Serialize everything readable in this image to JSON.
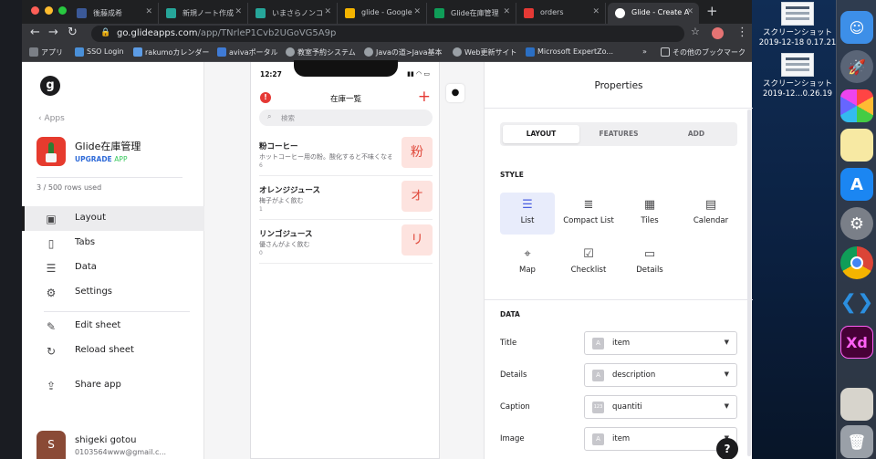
{
  "browser": {
    "tabs": [
      {
        "label": "後藤成希",
        "icon": "facebook-icon",
        "color": "#3b5998"
      },
      {
        "label": "新規ノート作成",
        "icon": "notion-icon",
        "color": "#26a69a"
      },
      {
        "label": "いまさらノンコ",
        "icon": "notion-icon",
        "color": "#26a69a"
      },
      {
        "label": "glide - Google",
        "icon": "google-drive-icon",
        "color": "#f4b400"
      },
      {
        "label": "Glide在庫管理",
        "icon": "sheets-icon",
        "color": "#0f9d58"
      },
      {
        "label": "orders",
        "icon": "app-icon",
        "color": "#e53935"
      },
      {
        "label": "Glide - Create A",
        "icon": "glide-icon",
        "color": "#ffffff"
      }
    ],
    "url_host": "go.glideapps.com",
    "url_path": "/app/TNrleP1Cvb2UGoVG5A9p",
    "bookmarks": [
      "アプリ",
      "SSO Login",
      "rakumoカレンダー",
      "avivaポータル",
      "教室予約システム",
      "Javaの道>Java基本",
      "Web更新サイト",
      "Microsoft ExpertZo..."
    ],
    "bookmarks_more": "»",
    "bookmarks_other": "その他のブックマーク"
  },
  "sidebar": {
    "back": "Apps",
    "app_name": "Glide在庫管理",
    "upgrade": "UPGRADE",
    "plan": "APP",
    "rows_used": "3 / 500 rows used",
    "menu": [
      {
        "label": "Layout",
        "icon": "layout-icon"
      },
      {
        "label": "Tabs",
        "icon": "tabs-icon"
      },
      {
        "label": "Data",
        "icon": "data-icon"
      },
      {
        "label": "Settings",
        "icon": "gear-icon"
      },
      {
        "label": "Edit sheet",
        "icon": "pencil-icon"
      },
      {
        "label": "Reload sheet",
        "icon": "reload-icon"
      },
      {
        "label": "Share app",
        "icon": "share-icon"
      }
    ],
    "user": {
      "initial": "S",
      "name": "shigeki gotou",
      "email": "0103564www@gmail.c..."
    }
  },
  "phone": {
    "time": "12:27",
    "title": "在庫一覧",
    "search_placeholder": "検索",
    "items": [
      {
        "title": "粉コーヒー",
        "details": "ホットコーヒー用の粉。酸化すると不味くなる",
        "caption": "6",
        "thumb": "粉"
      },
      {
        "title": "オレンジジュース",
        "details": "梅子がよく飲む",
        "caption": "1",
        "thumb": "オ"
      },
      {
        "title": "リンゴジュース",
        "details": "優さんがよく飲む",
        "caption": "0",
        "thumb": "リ"
      }
    ]
  },
  "properties": {
    "title": "Properties",
    "tabs": [
      "LAYOUT",
      "FEATURES",
      "ADD"
    ],
    "style_label": "STYLE",
    "styles": [
      {
        "label": "List",
        "icon": "list-icon"
      },
      {
        "label": "Compact List",
        "icon": "compact-list-icon"
      },
      {
        "label": "Tiles",
        "icon": "tiles-icon"
      },
      {
        "label": "Calendar",
        "icon": "calendar-icon"
      },
      {
        "label": "Map",
        "icon": "map-icon"
      },
      {
        "label": "Checklist",
        "icon": "checklist-icon"
      },
      {
        "label": "Details",
        "icon": "details-icon"
      }
    ],
    "data_label": "DATA",
    "fields": [
      {
        "label": "Title",
        "type": "A",
        "value": "item"
      },
      {
        "label": "Details",
        "type": "A",
        "value": "description"
      },
      {
        "label": "Caption",
        "type": "123",
        "value": "quantiti"
      },
      {
        "label": "Image",
        "type": "A",
        "value": "item"
      }
    ],
    "help": "?"
  },
  "desktop": {
    "screenshots": [
      {
        "line1": "スクリーンショット",
        "line2": "2019-12-18 0.17.21"
      },
      {
        "line1": "スクリーンショット",
        "line2": "2019-12...0.26.19"
      }
    ]
  }
}
